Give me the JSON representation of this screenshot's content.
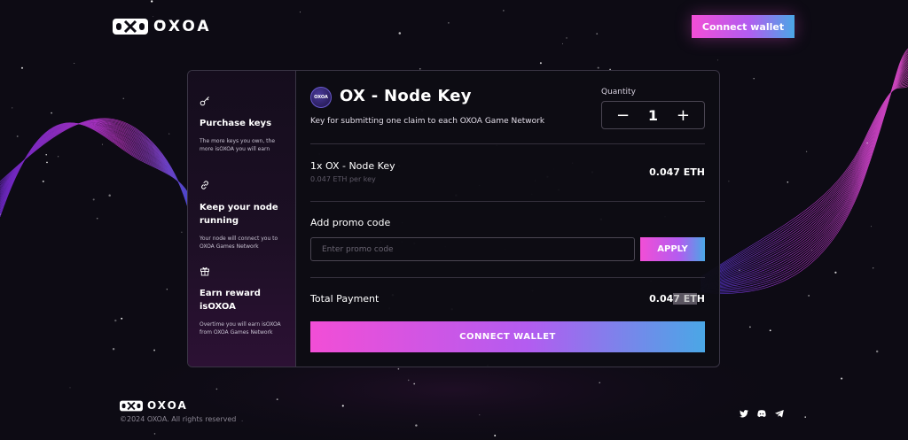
{
  "header": {
    "logo_text": "OXOA",
    "connect_button": "Connect wallet"
  },
  "steps": [
    {
      "icon": "key-icon",
      "title": "Purchase keys",
      "desc": "The more keys you own, the more isOXOA you will earn"
    },
    {
      "icon": "link-icon",
      "title": "Keep your node running",
      "desc": "Your node will connect you to OXOA Games Network"
    },
    {
      "icon": "gift-icon",
      "title": "Earn reward isOXOA",
      "desc": "Overtime you will earn isOXOA from OXOA Games Network"
    }
  ],
  "product": {
    "icon_text": "OXOA",
    "title": "OX - Node Key",
    "subtitle": "Key for submitting one claim to each OXOA Game Network",
    "quantity_label": "Quantity",
    "quantity": "1",
    "minus": "−",
    "plus": "+"
  },
  "line_item": {
    "name": "1x OX - Node Key",
    "per_key": "0.047 ETH per key",
    "price": "0.047 ETH"
  },
  "promo": {
    "label": "Add promo code",
    "placeholder": "Enter promo code",
    "apply": "APPLY"
  },
  "total": {
    "label": "Total Payment",
    "price_a": "0.04",
    "price_b": "7 ET",
    "price_c": "H"
  },
  "cta": "CONNECT WALLET",
  "footer": {
    "logo_text": "OXOA",
    "copyright": "©2024 OXOA. All rights reserved",
    "socials": [
      "twitter-icon",
      "discord-icon",
      "telegram-icon"
    ]
  },
  "colors": {
    "accent_pink": "#f24ed6",
    "accent_purple": "#b35cf0",
    "accent_blue": "#4aa7e6",
    "background": "#0d0b14"
  }
}
